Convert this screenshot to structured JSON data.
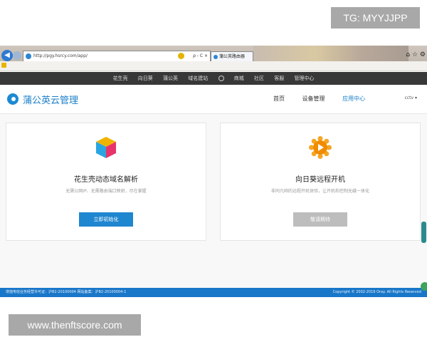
{
  "watermarks": {
    "top": "TG: MYYJJPP",
    "bottom": "www.thenftscore.com"
  },
  "browser": {
    "address": "http://pgy.hsrcy.com/app/",
    "tab_title": "蒲公英路由器",
    "address_tools": "ρ - C ×"
  },
  "site_nav": {
    "items": [
      "花生壳",
      "向日葵",
      "蒲公英",
      "域名建站",
      "商城",
      "社区",
      "客服",
      "管理中心"
    ]
  },
  "header": {
    "logo_text": "蒲公英云管理",
    "menu": [
      "首页",
      "设备管理",
      "应用中心"
    ],
    "active_menu": "应用中心",
    "account": "cctv ▾"
  },
  "cards": [
    {
      "title": "花生壳动态域名解析",
      "desc": "无需公网IP、无需路由端口映射，尽在掌握",
      "button": "立即初始化",
      "icon": "cube-icon"
    },
    {
      "title": "向日葵远程开机",
      "desc": "非同凡响的远程开机体验，让开机和控制无缝一体化",
      "button": "敬请期待",
      "icon": "sun-icon"
    }
  ],
  "footer": {
    "left": "增值电信业务经营许可证：沪B2-20100004  网站备案：沪B2-20100004-1",
    "right": "Copyright © 2002-2016 Oray. All Rights Reserved"
  },
  "colors": {
    "accent": "#1a7fc9",
    "nav_bg": "#383838",
    "footer_bg": "#1977c9",
    "disabled_btn": "#bdbdbd"
  }
}
